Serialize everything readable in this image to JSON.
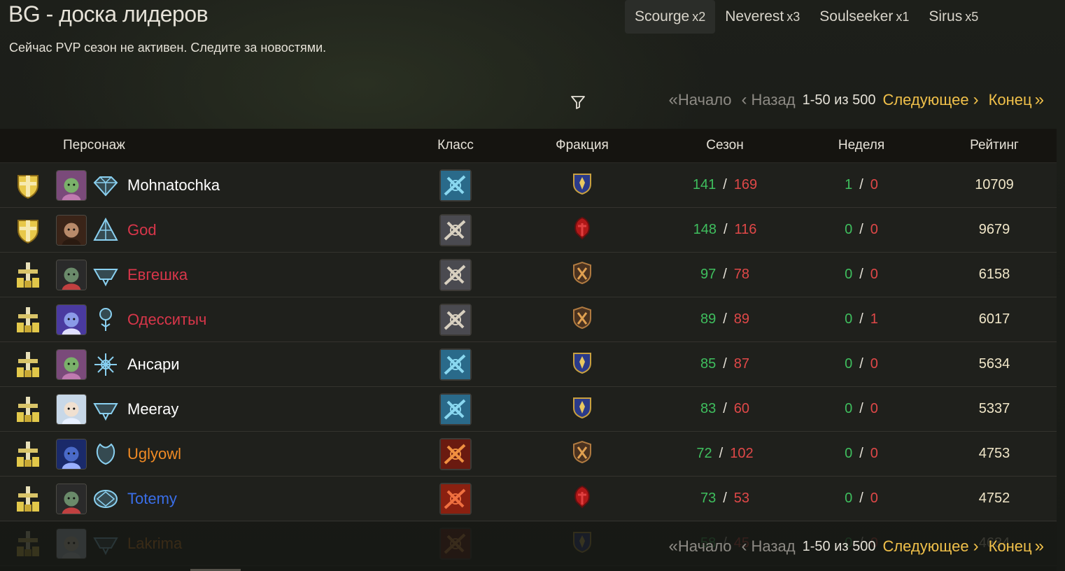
{
  "header": {
    "title": "BG - доска лидеров",
    "notice": "Сейчас PVP сезон не активен. Следите за новостями."
  },
  "realms": [
    {
      "name": "Scourge",
      "mult": "x2",
      "active": true
    },
    {
      "name": "Neverest",
      "mult": "x3",
      "active": false
    },
    {
      "name": "Soulseeker",
      "mult": "x1",
      "active": false
    },
    {
      "name": "Sirus",
      "mult": "x5",
      "active": false
    }
  ],
  "pager": {
    "first": "Начало",
    "prev": "Назад",
    "range": "1-50 из 500",
    "next": "Следующее",
    "last": "Конец"
  },
  "columns": {
    "character": "Персонаж",
    "class": "Класс",
    "faction": "Фракция",
    "season": "Сезон",
    "week": "Неделя",
    "rating": "Рейтинг"
  },
  "colors": {
    "accent": "#f0c04a",
    "win": "#3fbf5e",
    "loss": "#e04848",
    "name_white": "#ffffff",
    "name_red": "#d8364a",
    "name_orange": "#f08a24",
    "name_blue": "#3a6ee8"
  },
  "rows": [
    {
      "rank_icon": "rank-shield-icon",
      "portrait": "gnome-female-portrait",
      "spec_icon": "frost-spec-icon",
      "name": "Mohnatochka",
      "name_color": "#ffffff",
      "class_icon": "frost-class-icon",
      "faction": "alliance",
      "season_w": "141",
      "season_l": "169",
      "week_w": "1",
      "week_l": "0",
      "rating": "10709"
    },
    {
      "rank_icon": "rank-shield-icon",
      "portrait": "human-male-portrait",
      "spec_icon": "triangle-spec-icon",
      "name": "God",
      "name_color": "#d8364a",
      "class_icon": "skull-class-icon",
      "faction": "horde",
      "season_w": "148",
      "season_l": "116",
      "week_w": "0",
      "week_l": "0",
      "rating": "9679"
    },
    {
      "rank_icon": "rank-sword-icon",
      "portrait": "undead-portrait",
      "spec_icon": "bowl-spec-icon",
      "name": "Евгешка",
      "name_color": "#d8364a",
      "class_icon": "skull-class-icon",
      "faction": "renegade",
      "season_w": "97",
      "season_l": "78",
      "week_w": "0",
      "week_l": "0",
      "rating": "6158"
    },
    {
      "rank_icon": "rank-sword-icon",
      "portrait": "draenei-portrait",
      "spec_icon": "tree-spec-icon",
      "name": "Одесситыч",
      "name_color": "#d8364a",
      "class_icon": "skull-class-icon",
      "faction": "renegade",
      "season_w": "89",
      "season_l": "89",
      "week_w": "0",
      "week_l": "1",
      "rating": "6017"
    },
    {
      "rank_icon": "rank-sword-icon",
      "portrait": "gnome-female-portrait",
      "spec_icon": "star-spec-icon",
      "name": "Ансари",
      "name_color": "#ffffff",
      "class_icon": "frost-class-icon",
      "faction": "alliance",
      "season_w": "85",
      "season_l": "87",
      "week_w": "0",
      "week_l": "0",
      "rating": "5634"
    },
    {
      "rank_icon": "rank-sword-icon",
      "portrait": "elf-female-portrait",
      "spec_icon": "bowl-spec-icon",
      "name": "Meeray",
      "name_color": "#ffffff",
      "class_icon": "frost-class-icon",
      "faction": "alliance",
      "season_w": "83",
      "season_l": "60",
      "week_w": "0",
      "week_l": "0",
      "rating": "5337"
    },
    {
      "rank_icon": "rank-sword-icon",
      "portrait": "nightelf-portrait",
      "spec_icon": "spirit-spec-icon",
      "name": "Uglyowl",
      "name_color": "#f08a24",
      "class_icon": "fire-class-icon",
      "faction": "renegade",
      "season_w": "72",
      "season_l": "102",
      "week_w": "0",
      "week_l": "0",
      "rating": "4753"
    },
    {
      "rank_icon": "rank-sword-icon",
      "portrait": "undead-portrait",
      "spec_icon": "disc-spec-icon",
      "name": "Totemy",
      "name_color": "#3a6ee8",
      "class_icon": "horde-class-icon",
      "faction": "horde",
      "season_w": "73",
      "season_l": "53",
      "week_w": "0",
      "week_l": "0",
      "rating": "4752"
    },
    {
      "rank_icon": "rank-sword-icon",
      "portrait": "elf-female-portrait",
      "spec_icon": "bowl-spec-icon",
      "name": "Lakrima",
      "name_color": "#f08a24",
      "class_icon": "fire-class-icon",
      "faction": "alliance",
      "season_w": "58",
      "season_l": "45",
      "week_w": "0",
      "week_l": "0",
      "rating": "4634"
    }
  ]
}
